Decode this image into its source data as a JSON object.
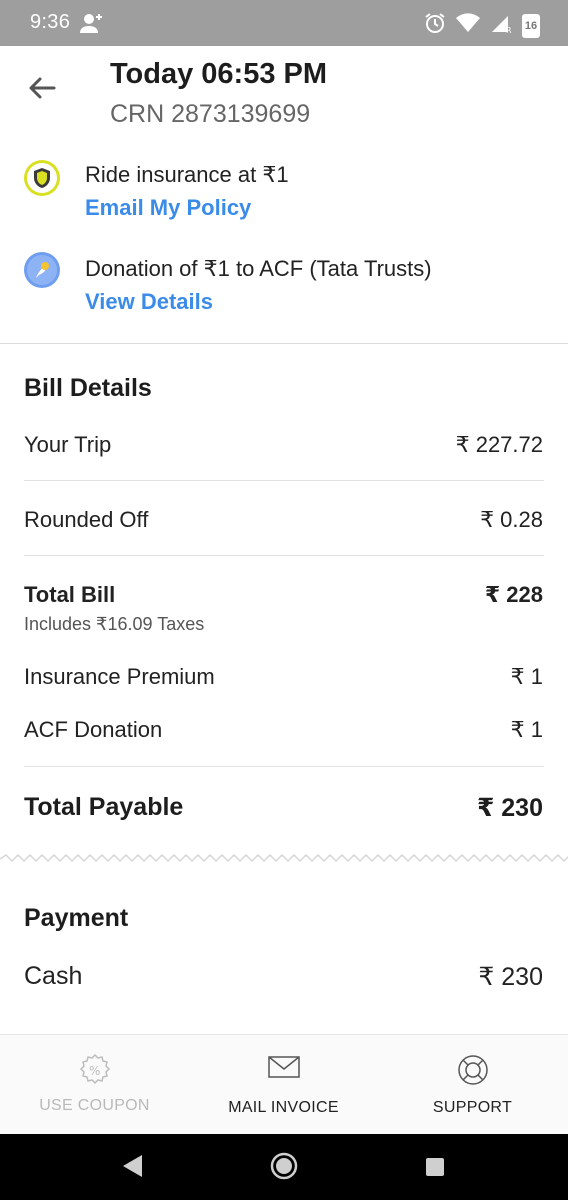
{
  "status_bar": {
    "time": "9:36",
    "battery": "16"
  },
  "header": {
    "title": "Today 06:53 PM",
    "subtitle": "CRN 2873139699"
  },
  "info": [
    {
      "text": "Ride insurance at ₹1",
      "link": "Email My Policy"
    },
    {
      "text": "Donation of ₹1 to ACF (Tata Trusts)",
      "link": "View Details"
    }
  ],
  "bill": {
    "title": "Bill Details",
    "your_trip": {
      "label": "Your Trip",
      "amount": "₹ 227.72"
    },
    "rounded_off": {
      "label": "Rounded Off",
      "amount": "₹ 0.28"
    },
    "total_bill": {
      "label": "Total Bill",
      "amount": "₹ 228",
      "note": "Includes ₹16.09 Taxes"
    },
    "insurance": {
      "label": "Insurance Premium",
      "amount": "₹ 1"
    },
    "acf": {
      "label": "ACF Donation",
      "amount": "₹ 1"
    },
    "total_payable": {
      "label": "Total Payable",
      "amount": "₹ 230"
    }
  },
  "payment": {
    "title": "Payment",
    "method": "Cash",
    "amount": "₹ 230"
  },
  "actions": {
    "coupon": "USE COUPON",
    "invoice": "MAIL INVOICE",
    "support": "SUPPORT"
  },
  "colors": {
    "link": "#3b8be8",
    "status_bar": "#9e9e9e",
    "shield": "#d9e021",
    "donation": "#6f9ef0"
  }
}
